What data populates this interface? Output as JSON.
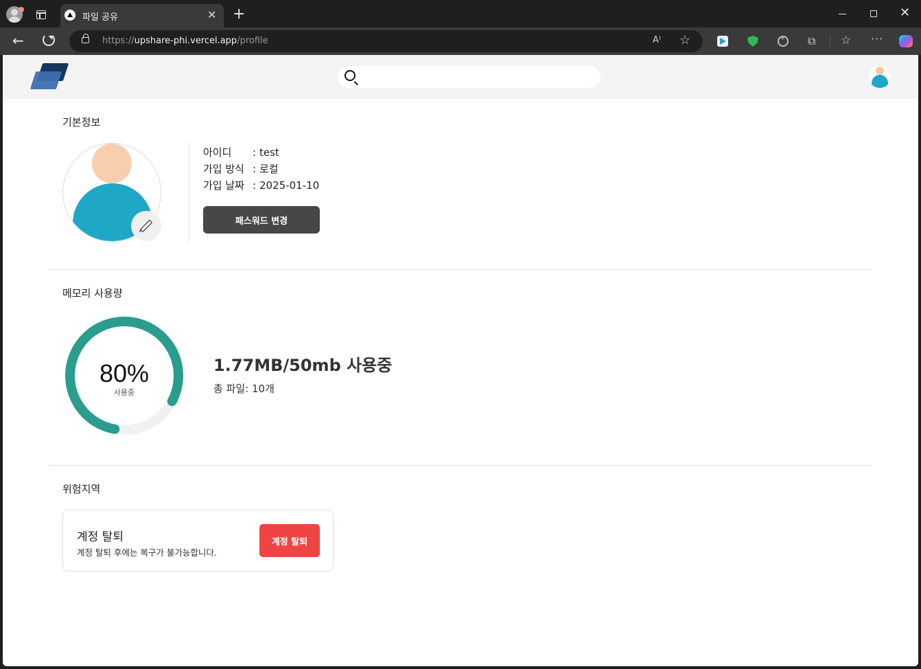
{
  "browser": {
    "tab_title": "파일 공유",
    "tab_close": "✕",
    "new_tab": "+",
    "url_scheme": "https://",
    "url_host": "upshare-phi.vercel.app",
    "url_path": "/profile",
    "read_aloud": "A⁾",
    "window_close": "✕"
  },
  "header": {
    "search": {
      "placeholder": "",
      "value": ""
    }
  },
  "basic_info": {
    "title": "기본정보",
    "fields": [
      {
        "label": "아이디",
        "value": "test"
      },
      {
        "label": "가입 방식",
        "value": "로컬"
      },
      {
        "label": "가입 날짜",
        "value": "2025-01-10"
      }
    ],
    "colon": ":",
    "password_button": "패스워드 변경"
  },
  "memory": {
    "title": "메모리 사용량",
    "percent_label": "80%",
    "percent_value": 80,
    "percent_sub": "사용중",
    "usage_text": "1.77MB/50mb 사용중",
    "file_count_text": "총 파일: 10개",
    "ring_color": "#2a9d8f",
    "track_color": "#f1f1f1"
  },
  "danger_zone": {
    "title": "위험지역",
    "card_title": "계정 탈퇴",
    "card_desc": "계정 탈퇴 후에는 복구가 불가능합니다.",
    "delete_button": "계정 탈퇴",
    "button_color": "#ef4444"
  }
}
